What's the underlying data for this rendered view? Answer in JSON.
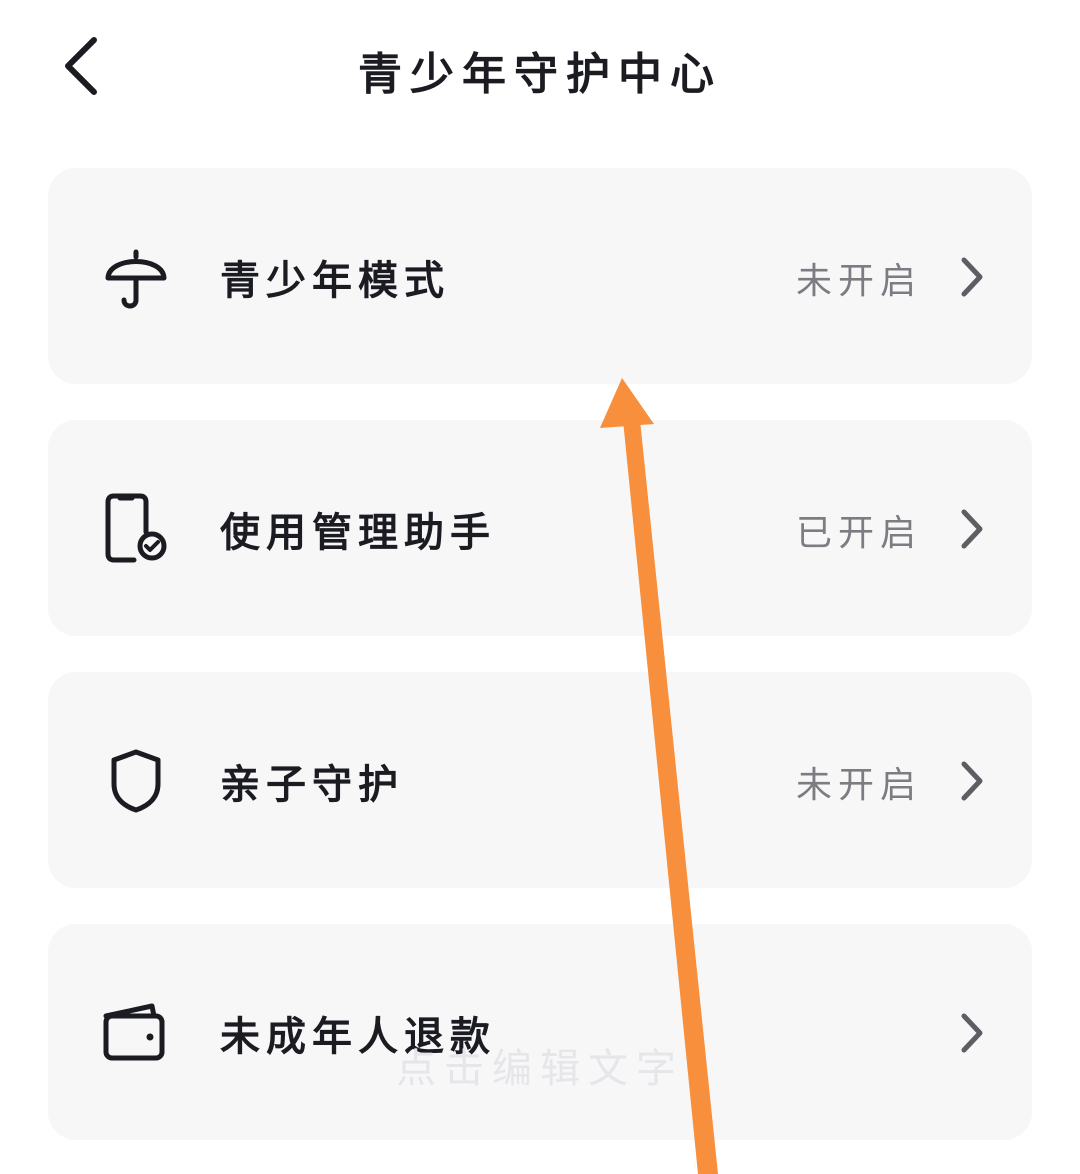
{
  "header": {
    "title": "青少年守护中心"
  },
  "menu_items": [
    {
      "label": "青少年模式",
      "status": "未开启",
      "icon": "umbrella-icon"
    },
    {
      "label": "使用管理助手",
      "status": "已开启",
      "icon": "phone-check-icon"
    },
    {
      "label": "亲子守护",
      "status": "未开启",
      "icon": "shield-icon"
    },
    {
      "label": "未成年人退款",
      "status": "",
      "icon": "wallet-icon"
    }
  ],
  "watermark": {
    "text": "点击编辑文字"
  },
  "colors": {
    "background": "#ffffff",
    "card": "#f7f7f8",
    "text": "#1b1b22",
    "status_text": "#7c7c82",
    "annotation_arrow": "#f78f3c"
  }
}
